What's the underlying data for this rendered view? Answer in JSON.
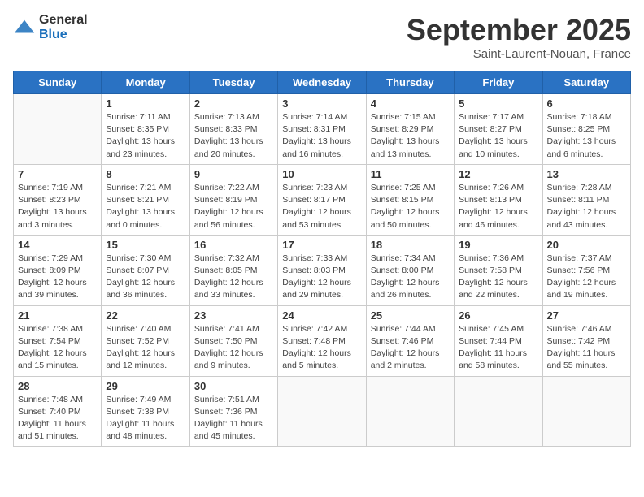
{
  "header": {
    "logo_general": "General",
    "logo_blue": "Blue",
    "month": "September 2025",
    "location": "Saint-Laurent-Nouan, France"
  },
  "days_of_week": [
    "Sunday",
    "Monday",
    "Tuesday",
    "Wednesday",
    "Thursday",
    "Friday",
    "Saturday"
  ],
  "weeks": [
    [
      {
        "day": "",
        "info": ""
      },
      {
        "day": "1",
        "info": "Sunrise: 7:11 AM\nSunset: 8:35 PM\nDaylight: 13 hours\nand 23 minutes."
      },
      {
        "day": "2",
        "info": "Sunrise: 7:13 AM\nSunset: 8:33 PM\nDaylight: 13 hours\nand 20 minutes."
      },
      {
        "day": "3",
        "info": "Sunrise: 7:14 AM\nSunset: 8:31 PM\nDaylight: 13 hours\nand 16 minutes."
      },
      {
        "day": "4",
        "info": "Sunrise: 7:15 AM\nSunset: 8:29 PM\nDaylight: 13 hours\nand 13 minutes."
      },
      {
        "day": "5",
        "info": "Sunrise: 7:17 AM\nSunset: 8:27 PM\nDaylight: 13 hours\nand 10 minutes."
      },
      {
        "day": "6",
        "info": "Sunrise: 7:18 AM\nSunset: 8:25 PM\nDaylight: 13 hours\nand 6 minutes."
      }
    ],
    [
      {
        "day": "7",
        "info": "Sunrise: 7:19 AM\nSunset: 8:23 PM\nDaylight: 13 hours\nand 3 minutes."
      },
      {
        "day": "8",
        "info": "Sunrise: 7:21 AM\nSunset: 8:21 PM\nDaylight: 13 hours\nand 0 minutes."
      },
      {
        "day": "9",
        "info": "Sunrise: 7:22 AM\nSunset: 8:19 PM\nDaylight: 12 hours\nand 56 minutes."
      },
      {
        "day": "10",
        "info": "Sunrise: 7:23 AM\nSunset: 8:17 PM\nDaylight: 12 hours\nand 53 minutes."
      },
      {
        "day": "11",
        "info": "Sunrise: 7:25 AM\nSunset: 8:15 PM\nDaylight: 12 hours\nand 50 minutes."
      },
      {
        "day": "12",
        "info": "Sunrise: 7:26 AM\nSunset: 8:13 PM\nDaylight: 12 hours\nand 46 minutes."
      },
      {
        "day": "13",
        "info": "Sunrise: 7:28 AM\nSunset: 8:11 PM\nDaylight: 12 hours\nand 43 minutes."
      }
    ],
    [
      {
        "day": "14",
        "info": "Sunrise: 7:29 AM\nSunset: 8:09 PM\nDaylight: 12 hours\nand 39 minutes."
      },
      {
        "day": "15",
        "info": "Sunrise: 7:30 AM\nSunset: 8:07 PM\nDaylight: 12 hours\nand 36 minutes."
      },
      {
        "day": "16",
        "info": "Sunrise: 7:32 AM\nSunset: 8:05 PM\nDaylight: 12 hours\nand 33 minutes."
      },
      {
        "day": "17",
        "info": "Sunrise: 7:33 AM\nSunset: 8:03 PM\nDaylight: 12 hours\nand 29 minutes."
      },
      {
        "day": "18",
        "info": "Sunrise: 7:34 AM\nSunset: 8:00 PM\nDaylight: 12 hours\nand 26 minutes."
      },
      {
        "day": "19",
        "info": "Sunrise: 7:36 AM\nSunset: 7:58 PM\nDaylight: 12 hours\nand 22 minutes."
      },
      {
        "day": "20",
        "info": "Sunrise: 7:37 AM\nSunset: 7:56 PM\nDaylight: 12 hours\nand 19 minutes."
      }
    ],
    [
      {
        "day": "21",
        "info": "Sunrise: 7:38 AM\nSunset: 7:54 PM\nDaylight: 12 hours\nand 15 minutes."
      },
      {
        "day": "22",
        "info": "Sunrise: 7:40 AM\nSunset: 7:52 PM\nDaylight: 12 hours\nand 12 minutes."
      },
      {
        "day": "23",
        "info": "Sunrise: 7:41 AM\nSunset: 7:50 PM\nDaylight: 12 hours\nand 9 minutes."
      },
      {
        "day": "24",
        "info": "Sunrise: 7:42 AM\nSunset: 7:48 PM\nDaylight: 12 hours\nand 5 minutes."
      },
      {
        "day": "25",
        "info": "Sunrise: 7:44 AM\nSunset: 7:46 PM\nDaylight: 12 hours\nand 2 minutes."
      },
      {
        "day": "26",
        "info": "Sunrise: 7:45 AM\nSunset: 7:44 PM\nDaylight: 11 hours\nand 58 minutes."
      },
      {
        "day": "27",
        "info": "Sunrise: 7:46 AM\nSunset: 7:42 PM\nDaylight: 11 hours\nand 55 minutes."
      }
    ],
    [
      {
        "day": "28",
        "info": "Sunrise: 7:48 AM\nSunset: 7:40 PM\nDaylight: 11 hours\nand 51 minutes."
      },
      {
        "day": "29",
        "info": "Sunrise: 7:49 AM\nSunset: 7:38 PM\nDaylight: 11 hours\nand 48 minutes."
      },
      {
        "day": "30",
        "info": "Sunrise: 7:51 AM\nSunset: 7:36 PM\nDaylight: 11 hours\nand 45 minutes."
      },
      {
        "day": "",
        "info": ""
      },
      {
        "day": "",
        "info": ""
      },
      {
        "day": "",
        "info": ""
      },
      {
        "day": "",
        "info": ""
      }
    ]
  ]
}
